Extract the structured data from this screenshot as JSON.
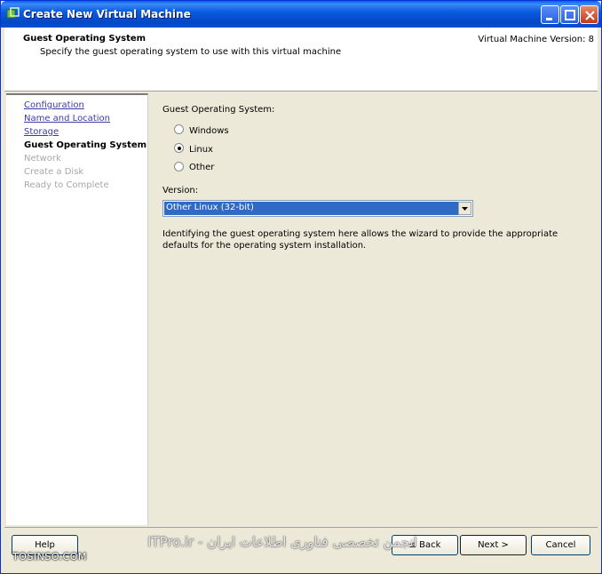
{
  "window": {
    "title": "Create New Virtual Machine",
    "icon": "vm-app-icon"
  },
  "header": {
    "title": "Guest Operating System",
    "subtitle": "Specify the guest operating system to use with this virtual machine",
    "version": "Virtual Machine Version: 8"
  },
  "steps": [
    {
      "label": "Configuration",
      "state": "link"
    },
    {
      "label": "Name and Location",
      "state": "link"
    },
    {
      "label": "Storage",
      "state": "link"
    },
    {
      "label": "Guest Operating System",
      "state": "current"
    },
    {
      "label": "Network",
      "state": "disabled"
    },
    {
      "label": "Create a Disk",
      "state": "disabled"
    },
    {
      "label": "Ready to Complete",
      "state": "disabled"
    }
  ],
  "main": {
    "os_label": "Guest Operating System:",
    "os_options": [
      {
        "label": "Windows",
        "checked": false
      },
      {
        "label": "Linux",
        "checked": true
      },
      {
        "label": "Other",
        "checked": false
      }
    ],
    "version_label": "Version:",
    "version_value": "Other Linux (32-bit)",
    "description": "Identifying the guest operating system here allows the wizard to provide the appropriate defaults for the operating system installation."
  },
  "buttons": {
    "help": "Help",
    "back": "≤ Back",
    "next": "Next >",
    "cancel": "Cancel"
  },
  "watermark": {
    "left": "TOSINSO.COM",
    "center": "انجمن تخصصی فناوری اطلاعات ایران - ITPro.ir"
  },
  "colors": {
    "titlebar": "#0b5ce0",
    "selection": "#316ac5",
    "link": "#3b3ba8"
  }
}
